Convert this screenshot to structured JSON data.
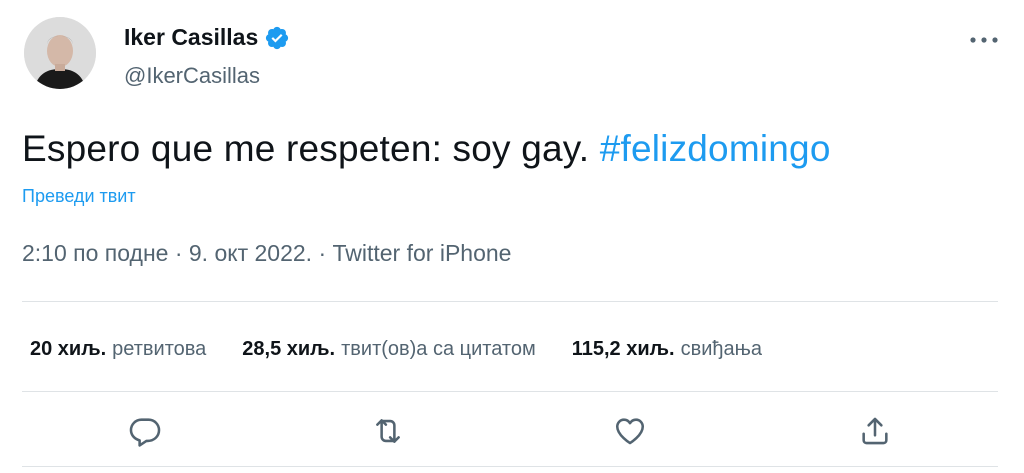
{
  "author": {
    "name": "Iker Casillas",
    "handle": "@IkerCasillas",
    "verified_color": "#1d9bf0"
  },
  "tweet": {
    "text": "Espero que me respeten: soy gay. ",
    "hashtag": "#felizdomingo",
    "translate_label": "Преведи твит",
    "meta": "2:10 по подне · 9. окт 2022. · Twitter for iPhone"
  },
  "stats": {
    "retweets_count": "20 хиљ.",
    "retweets_label": "ретвитова",
    "quotes_count": "28,5 хиљ.",
    "quotes_label": "твит(ов)а са цитатом",
    "likes_count": "115,2 хиљ.",
    "likes_label": "свиђања"
  },
  "icons": {
    "reply": "reply-icon",
    "retweet": "retweet-icon",
    "like": "heart-icon",
    "share": "share-icon",
    "more": "more-icon"
  }
}
